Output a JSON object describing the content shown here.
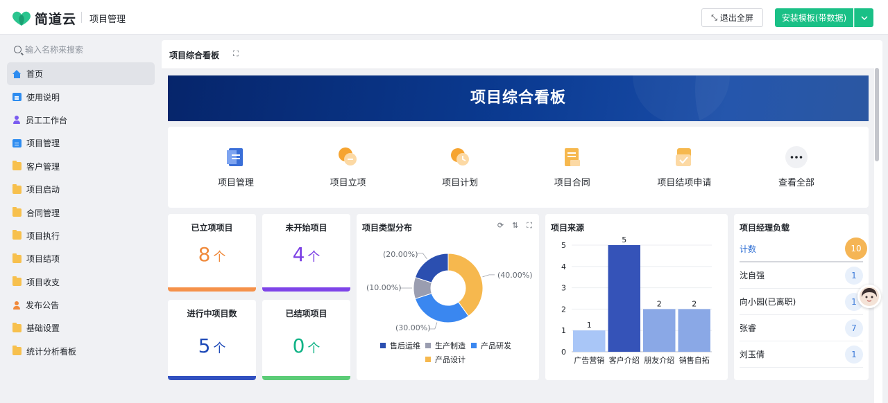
{
  "header": {
    "logo_text": "简道云",
    "app_name": "项目管理",
    "exit_fullscreen": "退出全屏",
    "install_template": "安装模板(带数据)"
  },
  "sidebar": {
    "search_placeholder": "输入名称来搜索",
    "items": [
      {
        "label": "首页",
        "icon": "home-icon"
      },
      {
        "label": "使用说明",
        "icon": "doc-icon"
      },
      {
        "label": "员工工作台",
        "icon": "user-icon"
      },
      {
        "label": "项目管理",
        "icon": "doc-icon"
      },
      {
        "label": "客户管理",
        "icon": "folder-icon"
      },
      {
        "label": "项目启动",
        "icon": "folder-icon"
      },
      {
        "label": "合同管理",
        "icon": "folder-icon"
      },
      {
        "label": "项目执行",
        "icon": "folder-icon"
      },
      {
        "label": "项目结项",
        "icon": "folder-icon"
      },
      {
        "label": "项目收支",
        "icon": "folder-icon"
      },
      {
        "label": "发布公告",
        "icon": "user-icon"
      },
      {
        "label": "基础设置",
        "icon": "folder-icon"
      },
      {
        "label": "统计分析看板",
        "icon": "folder-icon"
      }
    ]
  },
  "main": {
    "title": "项目综合看板",
    "banner_title": "项目综合看板",
    "shortcuts": [
      {
        "label": "项目管理",
        "icon": "bookmark-icon"
      },
      {
        "label": "项目立项",
        "icon": "coins-icon"
      },
      {
        "label": "项目计划",
        "icon": "clock-icon"
      },
      {
        "label": "项目合同",
        "icon": "contract-icon"
      },
      {
        "label": "项目结项申请",
        "icon": "check-doc-icon"
      },
      {
        "label": "查看全部",
        "icon": "more-icon"
      }
    ],
    "stats": [
      {
        "title": "已立项项目",
        "value": "8",
        "unit": "个",
        "color": "#f08a3c"
      },
      {
        "title": "未开始项目",
        "value": "4",
        "unit": "个",
        "color": "#7b3fe4"
      },
      {
        "title": "进行中项目数",
        "value": "5",
        "unit": "个",
        "color": "#1f4bb8"
      },
      {
        "title": "已结项项目",
        "value": "0",
        "unit": "个",
        "color": "#10b386"
      }
    ],
    "managers": {
      "title": "项目经理负载",
      "header_label": "计数",
      "header_value": "10",
      "rows": [
        {
          "name": "沈自强",
          "count": "1"
        },
        {
          "name": "向小园(已离职)",
          "count": "1"
        },
        {
          "name": "张睿",
          "count": "7"
        },
        {
          "name": "刘玉倩",
          "count": "1"
        }
      ]
    }
  },
  "chart_data": [
    {
      "type": "pie",
      "title": "项目类型分布",
      "donut": true,
      "categories": [
        "产品设计",
        "产品研发",
        "生产制造",
        "售后运维"
      ],
      "values": [
        40,
        30,
        10,
        20
      ],
      "labels": [
        "(40.00%)",
        "(30.00%)",
        "(10.00%)",
        "(20.00%)"
      ],
      "colors": [
        "#f6b84e",
        "#3a87f0",
        "#9a9db0",
        "#2b4fb0"
      ],
      "legend": [
        "售后运维",
        "生产制造",
        "产品研发",
        "产品设计"
      ],
      "legend_placement": "bottom"
    },
    {
      "type": "bar",
      "title": "项目来源",
      "categories": [
        "广告营销",
        "客户介绍",
        "朋友介绍",
        "销售自拓"
      ],
      "values": [
        1,
        5,
        2,
        2
      ],
      "colors": [
        "#a9c6f7",
        "#3553b8",
        "#8aa8e6",
        "#8aa8e6"
      ],
      "ylim": [
        0,
        5
      ],
      "yticks": [
        "0",
        "1",
        "2",
        "3",
        "4",
        "5"
      ],
      "grid": true
    }
  ]
}
